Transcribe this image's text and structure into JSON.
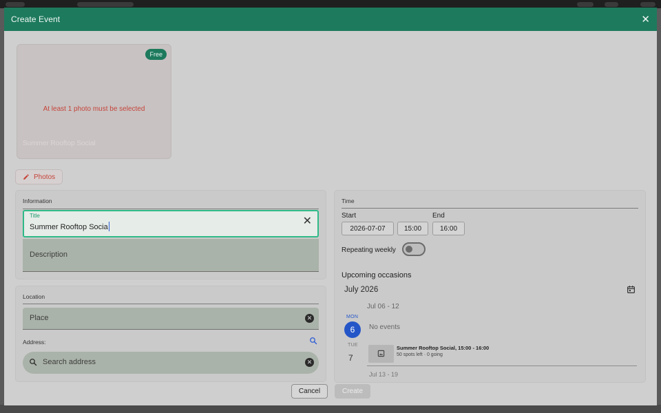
{
  "dialog": {
    "title": "Create Event"
  },
  "photo": {
    "badge": "Free",
    "error": "At least 1 photo must be selected",
    "caption": "Summer Rooftop Social",
    "edit_button": "Photos"
  },
  "information": {
    "section_label": "Information",
    "title_label": "Title",
    "title_value": "Summer Rooftop Socia",
    "description_placeholder": "Description"
  },
  "location": {
    "section_label": "Location",
    "place_placeholder": "Place",
    "address_label": "Address:",
    "search_placeholder": "Search address"
  },
  "time": {
    "section_label": "Time",
    "start_label": "Start",
    "start_date": "2026-07-07",
    "start_time": "15:00",
    "end_label": "End",
    "end_time": "16:00",
    "repeating_label": "Repeating weekly",
    "repeating_on": false
  },
  "upcoming": {
    "heading": "Upcoming occasions",
    "month": "July 2026",
    "week_range": "Jul 06 - 12",
    "days": [
      {
        "abbr": "MON",
        "num": "6",
        "text": "No events"
      },
      {
        "abbr": "TUE",
        "num": "7"
      }
    ],
    "event": {
      "title": "Summer Rooftop Social, 15:00 - 16:00",
      "subtitle": "50 spots left · 0 going"
    },
    "next_week_partial": "Jul 13 - 19"
  },
  "footer": {
    "cancel": "Cancel",
    "create": "Create"
  },
  "colors": {
    "header": "#1d7a5d",
    "focus": "#2eb987",
    "error": "#c5443a",
    "today": "#2556c8"
  },
  "icons": [
    "close-icon",
    "pencil-icon",
    "clear-icon",
    "clear-circle-icon",
    "search-icon",
    "calendar-icon",
    "image-icon"
  ]
}
